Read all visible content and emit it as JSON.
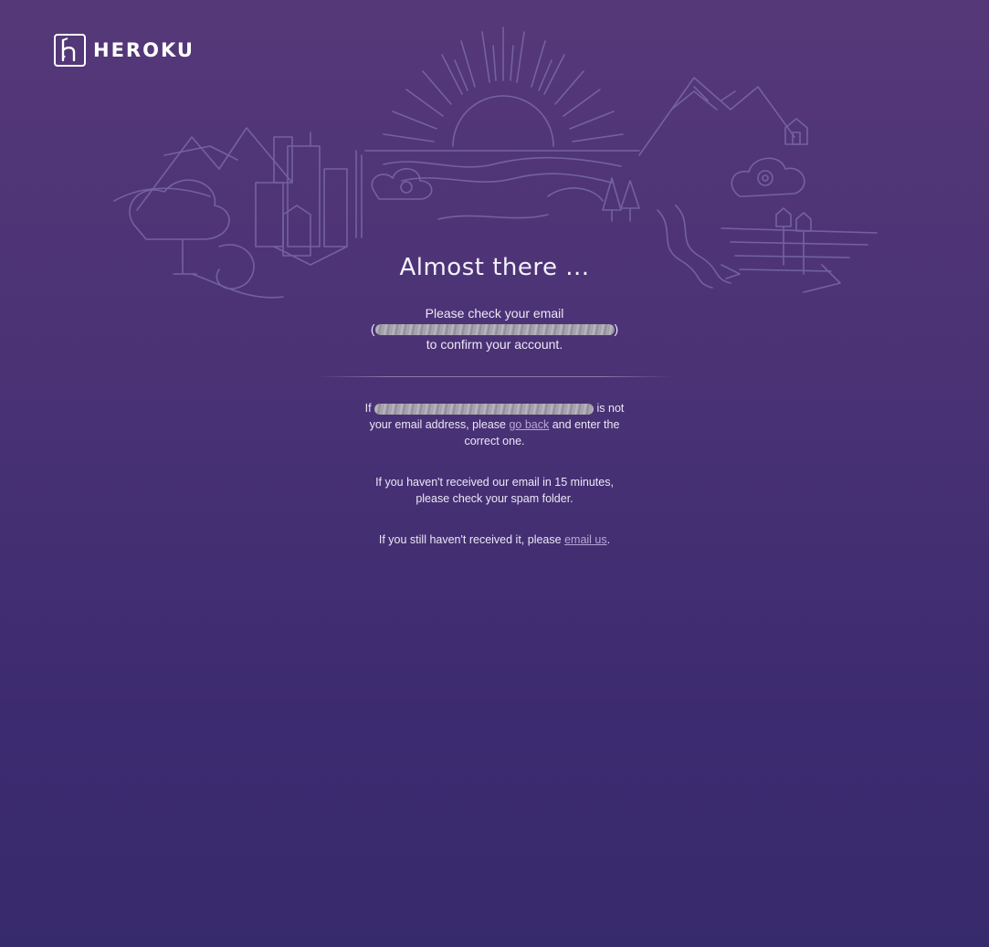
{
  "header": {
    "logo_text": "HEROKU"
  },
  "main": {
    "title": "Almost there ...",
    "confirm": {
      "line1": "Please check your email",
      "open_paren": "(",
      "close_paren": ")",
      "line3": "to confirm your account."
    },
    "wrong_email": {
      "prefix": "If",
      "suffix_1": "is not",
      "line2_before": "your email address, please",
      "go_back_link": "go back",
      "line2_after": "and enter the",
      "line3": "correct one."
    },
    "spam_note": {
      "line1": "If you haven't received our email in 15 minutes,",
      "line2": "please check your spam folder."
    },
    "still_note": {
      "text": "If you still haven't received it, please",
      "email_link": "email us",
      "end": "."
    }
  },
  "colors": {
    "background_top": "#553878",
    "background_bottom": "#372a6c",
    "link": "#b7a6d6",
    "illustration_line": "#7a6aa6"
  }
}
